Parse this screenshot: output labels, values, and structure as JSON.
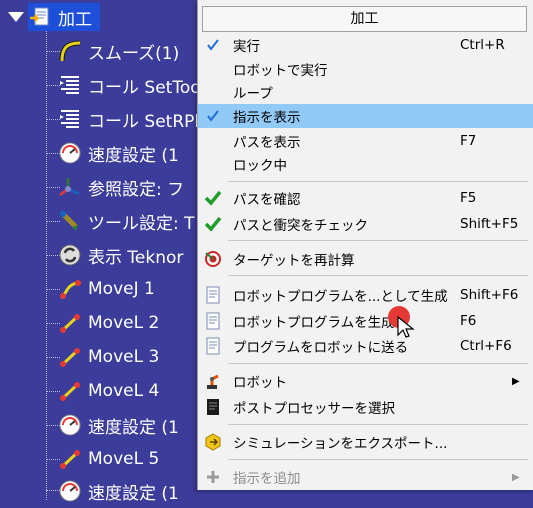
{
  "tree": {
    "root_label": "加工",
    "items": [
      {
        "label": "スムーズ(1)",
        "icon": "smooth-curve-icon"
      },
      {
        "label": "コール SetToo",
        "icon": "program-call-icon"
      },
      {
        "label": "コール SetRPl",
        "icon": "program-call-icon"
      },
      {
        "label": "速度設定 (1",
        "icon": "speed-gauge-icon"
      },
      {
        "label": "参照設定: フ",
        "icon": "reference-frame-icon"
      },
      {
        "label": "ツール設定: T",
        "icon": "tool-icon"
      },
      {
        "label": "表示 Teknor",
        "icon": "display-icon"
      },
      {
        "label": "MoveJ 1",
        "icon": "movej-icon"
      },
      {
        "label": "MoveL 2",
        "icon": "movel-icon"
      },
      {
        "label": "MoveL 3",
        "icon": "movel-icon"
      },
      {
        "label": "MoveL 4",
        "icon": "movel-icon"
      },
      {
        "label": "速度設定 (1",
        "icon": "speed-gauge-icon"
      },
      {
        "label": "MoveL 5",
        "icon": "movel-icon"
      },
      {
        "label": "速度設定 (1",
        "icon": "speed-gauge-icon"
      }
    ]
  },
  "menu": {
    "title": "加工",
    "items": [
      {
        "label": "実行",
        "shortcut": "Ctrl+R",
        "checked": true
      },
      {
        "label": "ロボットで実行",
        "shortcut": ""
      },
      {
        "label": "ループ",
        "shortcut": ""
      },
      {
        "label": "指示を表示",
        "shortcut": "",
        "checked": true,
        "highlighted": true
      },
      {
        "label": "パスを表示",
        "shortcut": "F7"
      },
      {
        "label": "ロック中",
        "shortcut": ""
      },
      {
        "label": "パスを確認",
        "shortcut": "F5",
        "icon": "green-check-icon"
      },
      {
        "label": "パスと衝突をチェック",
        "shortcut": "Shift+F5",
        "icon": "green-check-icon"
      },
      {
        "label": "ターゲットを再計算",
        "shortcut": "",
        "icon": "target-icon"
      },
      {
        "label": "ロボットプログラムを...として生成",
        "shortcut": "Shift+F6",
        "icon": "document-icon"
      },
      {
        "label": "ロボットプログラムを生成",
        "shortcut": "F6",
        "icon": "document-icon"
      },
      {
        "label": "プログラムをロボットに送る",
        "shortcut": "Ctrl+F6",
        "icon": "document-icon"
      },
      {
        "label": "ロボット",
        "shortcut": "",
        "icon": "robot-icon",
        "submenu": true
      },
      {
        "label": "ポストプロセッサーを選択",
        "shortcut": "",
        "icon": "post-processor-icon"
      },
      {
        "label": "シミュレーションをエクスポート...",
        "shortcut": "",
        "icon": "export-icon"
      },
      {
        "label": "指示を追加",
        "shortcut": "",
        "icon": "plus-icon",
        "disabled": true,
        "submenu": true
      }
    ]
  },
  "colors": {
    "tree_bg": "#3c3c9a",
    "highlight": "#91c9f7",
    "check_blue": "#1e6fd6",
    "check_green": "#1f9d2a"
  }
}
